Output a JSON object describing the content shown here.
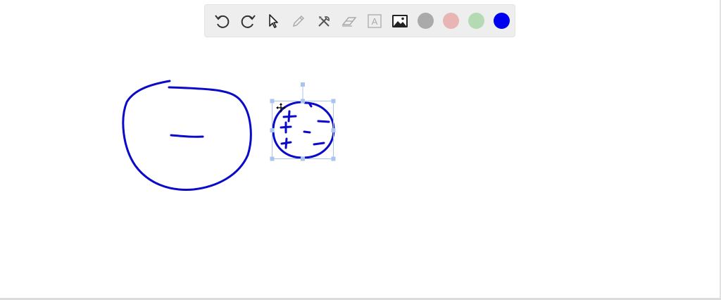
{
  "toolbar": {
    "tools": [
      {
        "name": "undo-icon",
        "state": "enabled"
      },
      {
        "name": "redo-icon",
        "state": "enabled"
      },
      {
        "name": "select-cursor-icon",
        "state": "active"
      },
      {
        "name": "pencil-icon",
        "state": "disabled"
      },
      {
        "name": "tools-icon",
        "state": "enabled"
      },
      {
        "name": "eraser-icon",
        "state": "disabled"
      },
      {
        "name": "text-icon",
        "state": "disabled"
      },
      {
        "name": "image-icon",
        "state": "enabled"
      }
    ],
    "text_tool_label": "A",
    "colors": [
      "#aaaaaa",
      "#e8b4b4",
      "#b4dab4",
      "#0000ee"
    ],
    "selected_color": "#0000ee"
  },
  "canvas": {
    "stroke_color": "#0a0ac8",
    "selection_color": "#a9c4ef",
    "large_circle_mark": "−",
    "small_circle_marks": [
      "+",
      "+",
      "+",
      "+",
      "−",
      "−",
      "−",
      "−"
    ]
  }
}
